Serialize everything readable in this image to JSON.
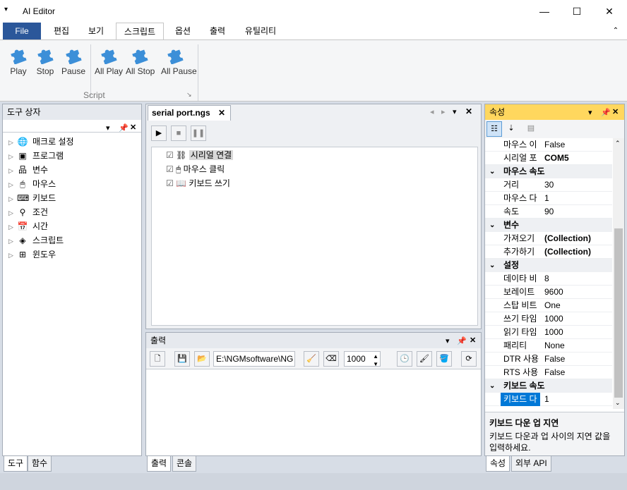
{
  "window": {
    "title": "AI Editor",
    "quick_access": "▾",
    "minimize": "—",
    "maximize": "☐",
    "close": "✕"
  },
  "menu": {
    "file": "File",
    "tabs": [
      "편집",
      "보기",
      "스크립트",
      "옵션",
      "출력",
      "유틸리티"
    ],
    "collapse": "⌃"
  },
  "ribbon": {
    "buttons": [
      "Play",
      "Stop",
      "Pause",
      "All Play",
      "All Stop",
      "All Pause"
    ],
    "group_label": "Script",
    "launcher": "↘"
  },
  "toolbox": {
    "title": "도구 상자",
    "items": [
      "매크로 설정",
      "프로그램",
      "변수",
      "마우스",
      "키보드",
      "조건",
      "시간",
      "스크립트",
      "윈도우"
    ],
    "tabs": [
      "도구",
      "함수"
    ]
  },
  "document": {
    "tab": "serial port.ngs",
    "steps": [
      "시리얼 연결",
      "마우스 클릭",
      "키보드 쓰기"
    ]
  },
  "output": {
    "title": "출력",
    "path": "E:\\NGMsoftware\\NG",
    "count": "1000",
    "tabs": [
      "출력",
      "콘솔"
    ]
  },
  "properties": {
    "title": "속성",
    "rows": [
      {
        "type": "prop",
        "name": "마우스 이",
        "value": "False"
      },
      {
        "type": "prop",
        "name": "시리얼 포",
        "value": "COM5",
        "bold": true
      },
      {
        "type": "cat",
        "name": "마우스 속도"
      },
      {
        "type": "prop",
        "name": "거리",
        "value": "30"
      },
      {
        "type": "prop",
        "name": "마우스 다",
        "value": "1"
      },
      {
        "type": "prop",
        "name": "속도",
        "value": "90"
      },
      {
        "type": "cat",
        "name": "변수"
      },
      {
        "type": "prop",
        "name": "가져오기",
        "value": "(Collection)",
        "bold": true
      },
      {
        "type": "prop",
        "name": "추가하기",
        "value": "(Collection)",
        "bold": true
      },
      {
        "type": "cat",
        "name": "설정"
      },
      {
        "type": "prop",
        "name": "데이타 비",
        "value": "8"
      },
      {
        "type": "prop",
        "name": "보레이트",
        "value": "9600"
      },
      {
        "type": "prop",
        "name": "스탑 비트",
        "value": "One"
      },
      {
        "type": "prop",
        "name": "쓰기 타임",
        "value": "1000"
      },
      {
        "type": "prop",
        "name": "읽기 타임",
        "value": "1000"
      },
      {
        "type": "prop",
        "name": "패리티",
        "value": "None"
      },
      {
        "type": "prop",
        "name": "DTR 사용",
        "value": "False"
      },
      {
        "type": "prop",
        "name": "RTS 사용",
        "value": "False"
      },
      {
        "type": "cat",
        "name": "키보드 속도"
      },
      {
        "type": "prop",
        "name": "키보드 다",
        "value": "1",
        "selected": true
      }
    ],
    "desc_title": "키보드 다운 업 지연",
    "desc_text": "키보드 다운과 업 사이의 지연 값을 입력하세요.",
    "tabs": [
      "속성",
      "외부 API"
    ]
  },
  "colors": {
    "accent": "#2b579a",
    "active_header": "#ffd75e",
    "selection": "#0078d7"
  }
}
